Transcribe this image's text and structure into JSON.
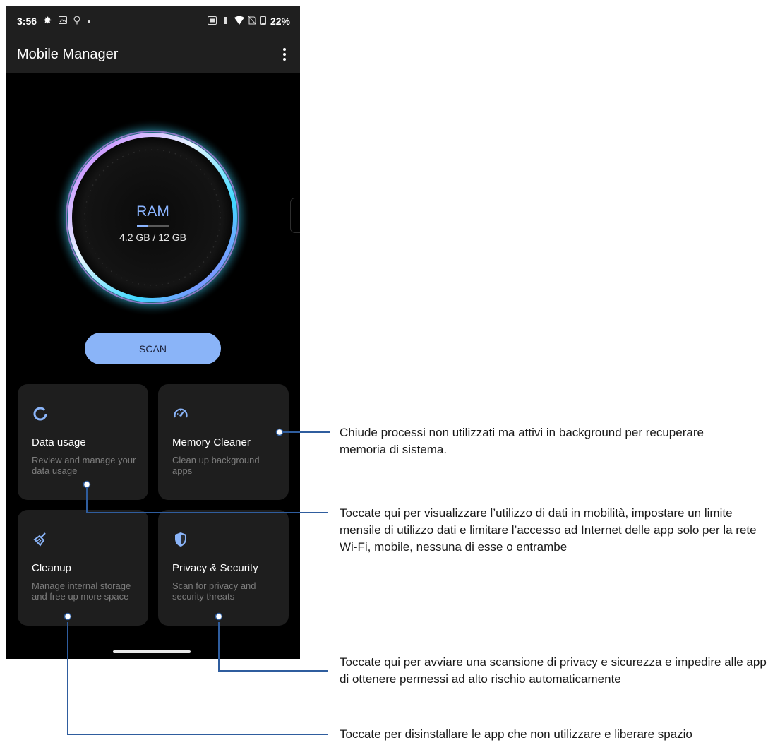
{
  "statusbar": {
    "time": "3:56",
    "battery": "22%",
    "left_icons": [
      "gear-icon",
      "image-icon",
      "bulb-icon",
      "dot-icon"
    ],
    "right_icons": [
      "nfc-icon",
      "vibrate-icon",
      "wifi-icon",
      "no-sim-icon",
      "battery-icon"
    ]
  },
  "appbar": {
    "title": "Mobile Manager"
  },
  "ram": {
    "label": "RAM",
    "value": "4.2 GB / 12 GB",
    "fill_fraction": 0.35
  },
  "scan_label": "SCAN",
  "cards": {
    "data_usage": {
      "title": "Data usage",
      "desc": "Review and manage your data usage",
      "icon": "circle-progress-icon"
    },
    "memory_cleaner": {
      "title": "Memory Cleaner",
      "desc": "Clean up background apps",
      "icon": "speedometer-icon"
    },
    "cleanup": {
      "title": "Cleanup",
      "desc": "Manage internal storage and free up more space",
      "icon": "broom-icon"
    },
    "privacy": {
      "title": "Privacy & Security",
      "desc": "Scan for privacy and security threats",
      "icon": "shield-icon"
    }
  },
  "callouts": {
    "memory": "Chiude processi non utilizzati ma attivi in background per recuperare memoria di sistema.",
    "data": "Toccate qui per visualizzare l’utilizzo di dati in mobilità, impostare un limite mensile di utilizzo dati e limitare l’accesso ad Internet delle app solo per la rete Wi-Fi, mobile, nessuna di esse o entrambe",
    "privacy": "Toccate qui per avviare una scansione di privacy e sicurezza e impedire alle app di ottenere permessi ad alto rischio automaticamente",
    "cleanup": "Toccate per disinstallare le app che non utilizzare e liberare spazio"
  },
  "colors": {
    "accent": "#8ab4f8",
    "card_bg": "#1e1e1e",
    "callout_line": "#2f5d9e"
  }
}
